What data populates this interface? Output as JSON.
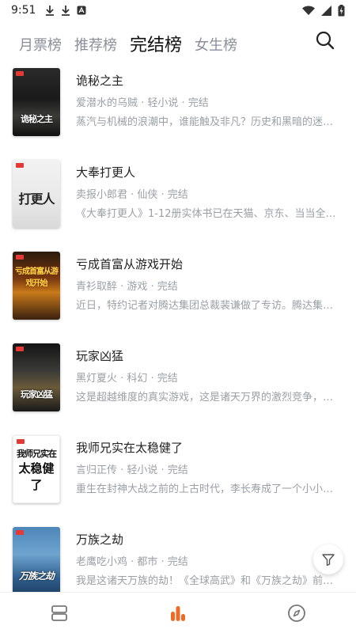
{
  "status_bar": {
    "time": "9:51"
  },
  "tabs": [
    {
      "label": "月票榜",
      "active": false
    },
    {
      "label": "推荐榜",
      "active": false
    },
    {
      "label": "完结榜",
      "active": true
    },
    {
      "label": "女生榜",
      "active": false
    }
  ],
  "books": [
    {
      "title": "诡秘之主",
      "meta": "爱潜水的乌贼 · 轻小说 · 完结",
      "desc": "蒸汽与机械的浪潮中，谁能触及非凡？历史和黑暗的迷雾…",
      "cover_text": "诡秘之主"
    },
    {
      "title": "大奉打更人",
      "meta": "卖报小郎君 · 仙侠 · 完结",
      "desc": "《大奉打更人》1-12册实体书已在天猫、京东、当当全平…",
      "cover_text": "打更人"
    },
    {
      "title": "亏成首富从游戏开始",
      "meta": "青衫取醉 · 游戏 · 完结",
      "desc": "近日，特约记者对腾达集团总裁裴谦做了专访。腾达集团…",
      "cover_text": "亏成首富从游戏开始"
    },
    {
      "title": "玩家凶猛",
      "meta": "黑灯夏火 · 科幻 · 完结",
      "desc": "这是超越维度的真实游戏，这是诸天万界的激烈竞争，波…",
      "cover_text": "玩家凶猛"
    },
    {
      "title": "我师兄实在太稳健了",
      "meta": "言归正传 · 轻小说 · 完结",
      "desc": "重生在封神大战之前的上古时代，李长寿成了一个小小的…",
      "cover_text": "我师兄实在",
      "cover_text2": "太稳健了"
    },
    {
      "title": "万族之劫",
      "meta": "老鹰吃小鸡 · 都市 · 完结",
      "desc": "我是这诸天万族的劫！《全球高武》和《万族之劫》前五…",
      "cover_text": "万族之劫"
    }
  ],
  "icons": {
    "search": "search-icon",
    "filter": "filter-icon",
    "nav": [
      "bookshelf-icon",
      "ranking-icon",
      "discover-icon"
    ]
  },
  "colors": {
    "accent": "#f06a25",
    "muted": "#9aa0a6",
    "inactive_tab": "#8a8f98"
  }
}
